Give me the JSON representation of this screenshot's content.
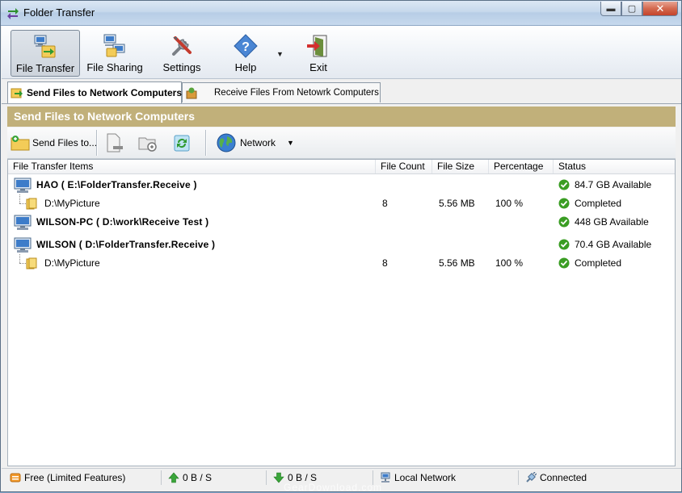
{
  "window": {
    "title": "Folder Transfer",
    "controls": {
      "minimize": "▬",
      "maximize": "▢",
      "close": "✕"
    }
  },
  "toolbar": {
    "file_transfer": "File Transfer",
    "file_sharing": "File Sharing",
    "settings": "Settings",
    "help": "Help",
    "help_dropdown": "▼",
    "exit": "Exit"
  },
  "tabs": [
    {
      "label": "Send Files to Network Computers",
      "icon": "send-files-icon"
    },
    {
      "label": "Receive Files From Netowrk Computers",
      "icon": "receive-files-icon"
    }
  ],
  "section": {
    "title": "Send Files to Network Computers"
  },
  "subtoolbar": {
    "send_files": "Send Files to...",
    "network": "Network",
    "network_dropdown": "▼"
  },
  "list": {
    "columns": [
      "File Transfer Items",
      "File Count",
      "File Size",
      "Percentage",
      "Status"
    ],
    "rows": [
      {
        "type": "host",
        "name": "HAO ( E:\\FolderTransfer.Receive )",
        "count": "",
        "size": "",
        "pct": "",
        "status": "84.7 GB Available"
      },
      {
        "type": "folder",
        "name": "D:\\MyPicture",
        "count": "8",
        "size": "5.56 MB",
        "pct": "100 %",
        "status": "Completed"
      },
      {
        "type": "host",
        "name": "WILSON-PC ( D:\\work\\Receive Test )",
        "count": "",
        "size": "",
        "pct": "",
        "status": "448 GB Available"
      },
      {
        "type": "host",
        "name": "WILSON ( D:\\FolderTransfer.Receive )",
        "count": "",
        "size": "",
        "pct": "",
        "status": "70.4 GB Available"
      },
      {
        "type": "folder",
        "name": "D:\\MyPicture",
        "count": "8",
        "size": "5.56 MB",
        "pct": "100 %",
        "status": "Completed"
      }
    ]
  },
  "statusbar": {
    "license": "Free (Limited Features)",
    "upload": "0 B / S",
    "download": "0 B / S",
    "network": "Local Network",
    "connection": "Connected"
  },
  "watermark": "GearDownload.com",
  "colors": {
    "section_header": "#c1b07a",
    "ok_green": "#3a9d23",
    "accent": "#2b6cb0"
  }
}
